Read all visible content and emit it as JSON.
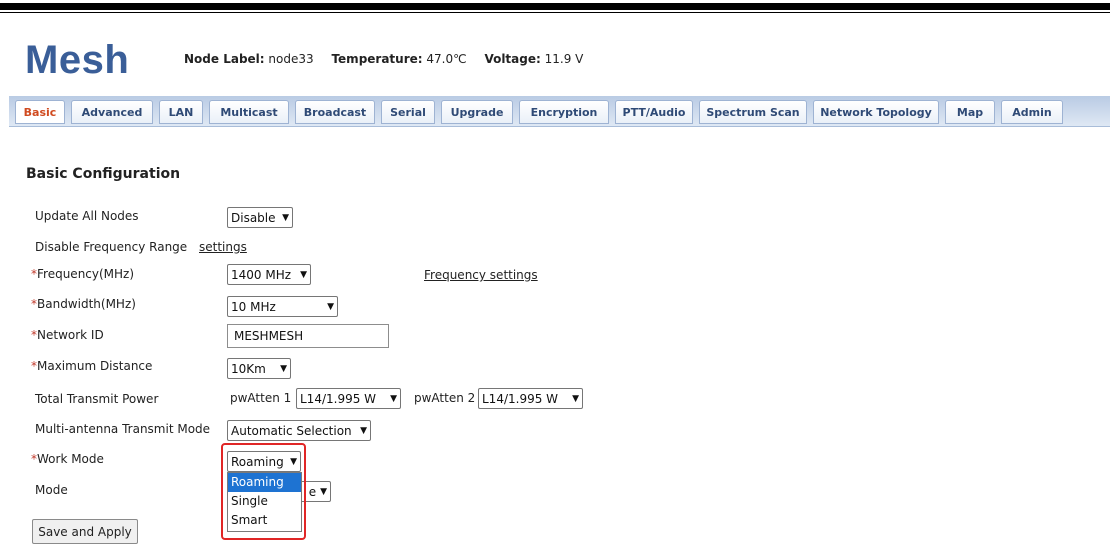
{
  "header": {
    "logo": "Mesh",
    "node_label_key": "Node Label:",
    "node_label_value": "node33",
    "temperature_key": "Temperature:",
    "temperature_value": "47.0℃",
    "voltage_key": "Voltage:",
    "voltage_value": "11.9 V"
  },
  "tabs": [
    {
      "label": "Basic",
      "active": true
    },
    {
      "label": "Advanced"
    },
    {
      "label": "LAN"
    },
    {
      "label": "Multicast"
    },
    {
      "label": "Broadcast"
    },
    {
      "label": "Serial"
    },
    {
      "label": "Upgrade"
    },
    {
      "label": "Encryption"
    },
    {
      "label": "PTT/Audio"
    },
    {
      "label": "Spectrum Scan"
    },
    {
      "label": "Network Topology"
    },
    {
      "label": "Map"
    },
    {
      "label": "Admin"
    }
  ],
  "section_title": "Basic Configuration",
  "form": {
    "update_all_nodes": {
      "label": "Update All Nodes",
      "value": "Disable"
    },
    "disable_freq_range": {
      "label": "Disable Frequency Range",
      "link": "settings"
    },
    "frequency": {
      "label": "Frequency(MHz)",
      "value": "1400 MHz",
      "link": "Frequency settings"
    },
    "bandwidth": {
      "label": "Bandwidth(MHz)",
      "value": "10 MHz"
    },
    "network_id": {
      "label": "Network ID",
      "value": "MESHMESH"
    },
    "max_distance": {
      "label": "Maximum Distance",
      "value": "10Km"
    },
    "transmit_power": {
      "label": "Total Transmit Power",
      "pwatten1_label": "pwAtten 1",
      "pwatten1_value": "L14/1.995 W",
      "pwatten2_label": "pwAtten 2",
      "pwatten2_value": "L14/1.995 W"
    },
    "multi_antenna": {
      "label": "Multi-antenna Transmit Mode",
      "value": "Automatic Selection"
    },
    "work_mode": {
      "label": "Work Mode",
      "value": "Roaming",
      "options": [
        "Roaming",
        "Single",
        "Smart"
      ]
    },
    "mode": {
      "label": "Mode",
      "value_fragment": "e"
    },
    "required_mark": "*",
    "save_button": "Save and Apply"
  },
  "colors": {
    "logo": "#3a5e98",
    "active_tab": "#d04a1f",
    "required": "#c0392b",
    "highlight": "#e02626",
    "dropdown_selected": "#1e73d2"
  }
}
